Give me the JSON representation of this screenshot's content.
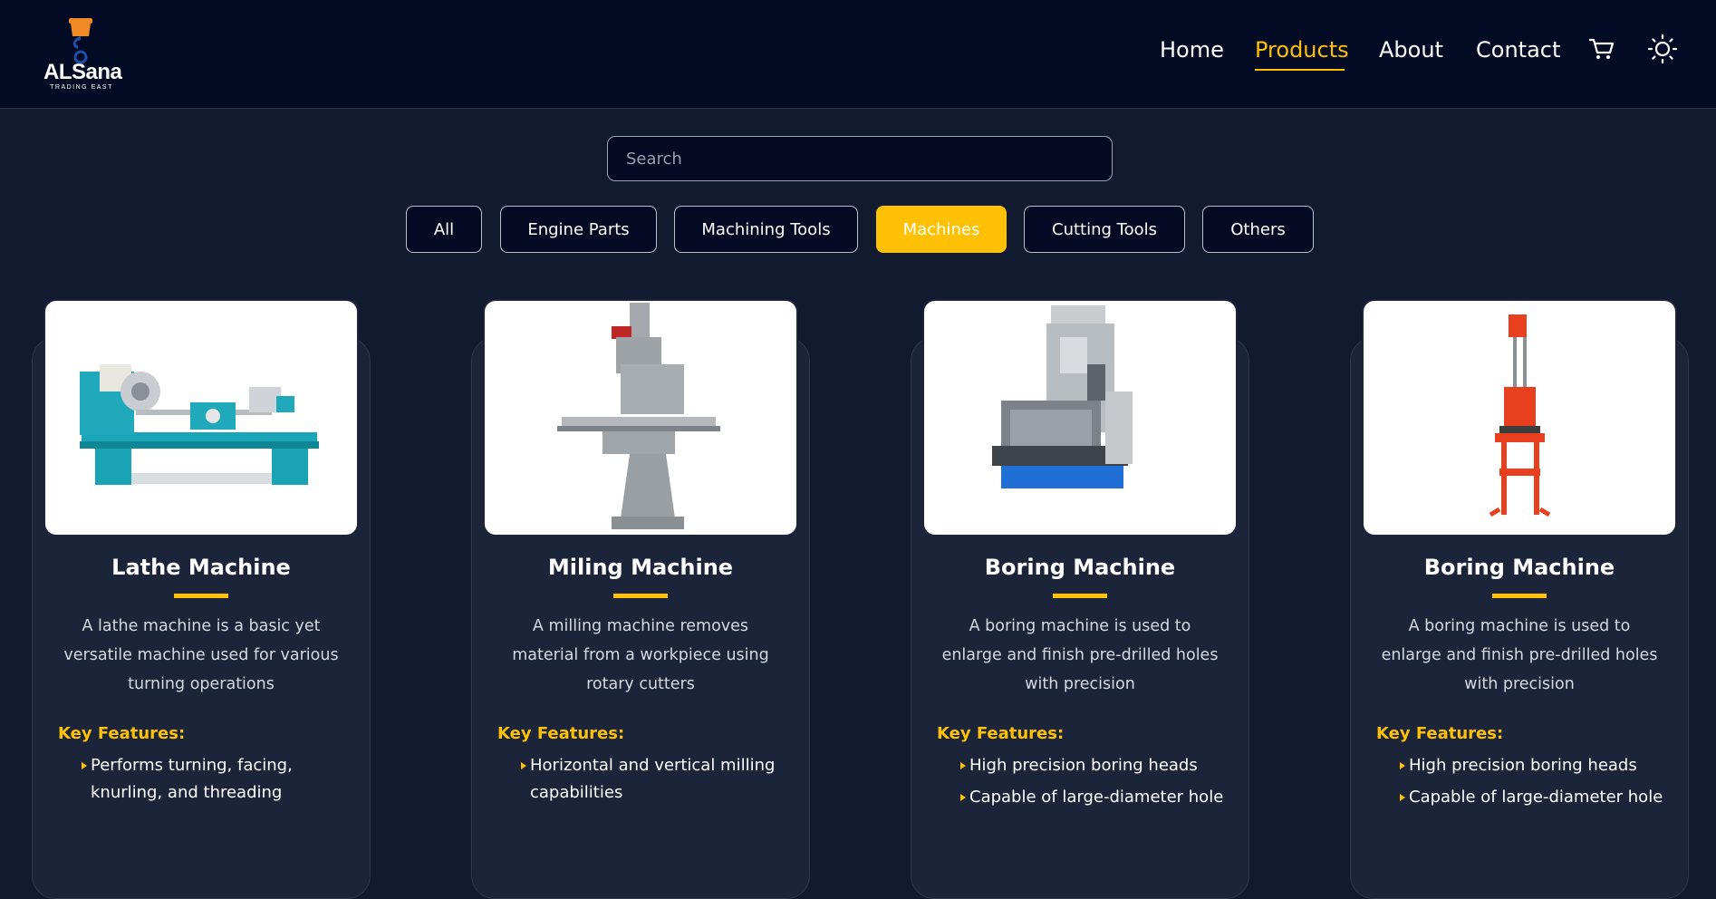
{
  "brand": {
    "name": "ALSana",
    "tagline": "TRADING EAST"
  },
  "nav": {
    "home": "Home",
    "products": "Products",
    "about": "About",
    "contact": "Contact"
  },
  "icons": {
    "cart": "cart-icon",
    "theme": "sun-icon"
  },
  "search": {
    "placeholder": "Search",
    "value": ""
  },
  "filters": [
    "All",
    "Engine Parts",
    "Machining Tools",
    "Machines",
    "Cutting Tools",
    "Others"
  ],
  "active_filter": "Machines",
  "colors": {
    "accent": "#ffc106",
    "header": "#020a24",
    "background": "#111a2e",
    "card": "#1b2438"
  },
  "key_features_label": "Key Features:",
  "products": [
    {
      "title": "Lathe Machine",
      "description": "A lathe machine is a basic yet versatile machine used for various turning operations",
      "features": [
        "Performs turning, facing, knurling, and threading"
      ]
    },
    {
      "title": "Miling Machine",
      "description": "A milling machine removes material from a workpiece using rotary cutters",
      "features": [
        "Horizontal and vertical milling capabilities"
      ]
    },
    {
      "title": "Boring Machine",
      "description": "A boring machine is used to enlarge and finish pre-drilled holes with precision",
      "features": [
        "High precision boring heads",
        "Capable of large-diameter hole"
      ]
    },
    {
      "title": "Boring Machine",
      "description": "A boring machine is used to enlarge and finish pre-drilled holes with precision",
      "features": [
        "High precision boring heads",
        "Capable of large-diameter hole"
      ]
    }
  ]
}
